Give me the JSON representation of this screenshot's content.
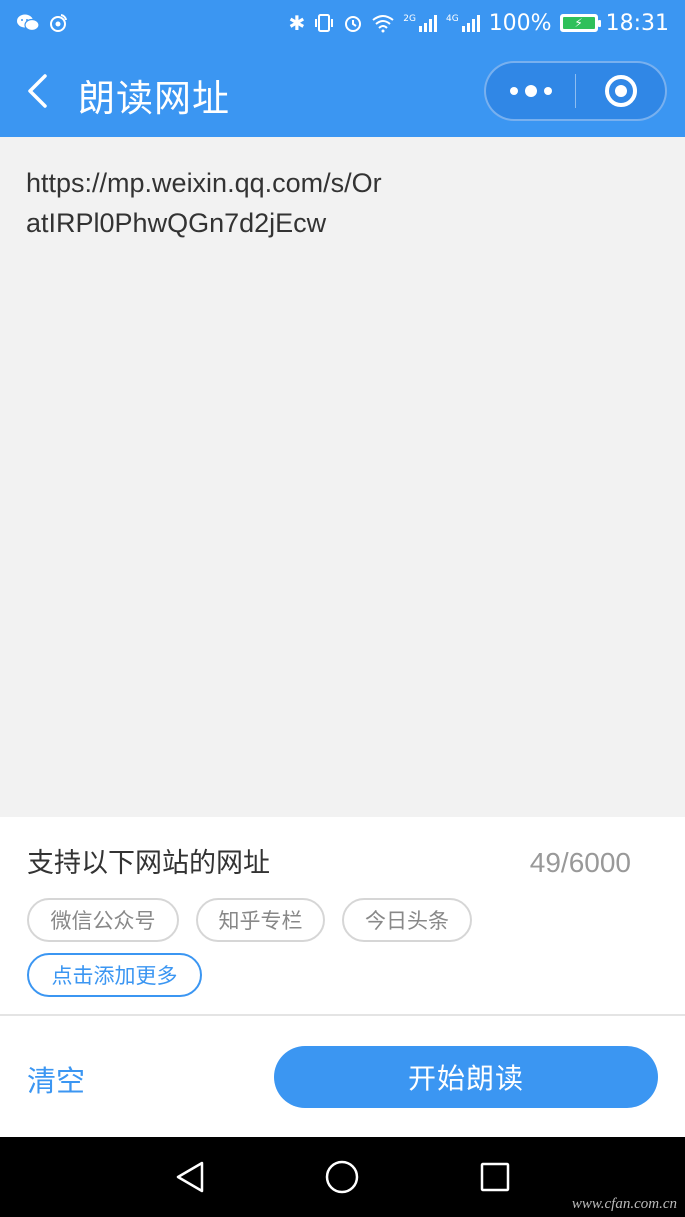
{
  "status_bar": {
    "battery": "100%",
    "time": "18:31",
    "network_2g": "2G",
    "network_4g": "4G"
  },
  "nav": {
    "title": "朗读网址"
  },
  "content": {
    "url": "https://mp.weixin.qq.com/s/OratIRPl0PhwQGn7d2jEcw"
  },
  "support": {
    "title": "支持以下网站的网址",
    "count": "49/6000",
    "tags": [
      "微信公众号",
      "知乎专栏",
      "今日头条"
    ],
    "add_more": "点击添加更多"
  },
  "actions": {
    "clear": "清空",
    "start": "开始朗读"
  },
  "watermark": "www.cfan.com.cn",
  "colors": {
    "primary": "#3b96f2",
    "battery": "#2fc05a"
  }
}
